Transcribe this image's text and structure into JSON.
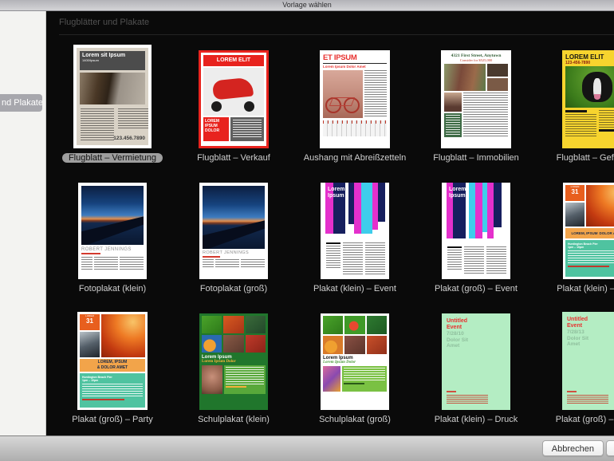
{
  "window": {
    "title": "Vorlage wählen"
  },
  "sidebar": {
    "selected_item": "nd Plakate"
  },
  "section": {
    "header": "Flugblätter und Plakate"
  },
  "templates": [
    {
      "label": "Flugblatt – Vermietung",
      "selected": true,
      "art": {
        "title": "Lorem sit Ipsum",
        "subtitle": "1400/Ipsum",
        "phone": "123.456.7890"
      }
    },
    {
      "label": "Flugblatt – Verkauf",
      "selected": false,
      "art": {
        "band": "LOREM ELIT",
        "box": "LOREM IPSUM DOLOR"
      }
    },
    {
      "label": "Aushang mit Abreißzetteln",
      "selected": false,
      "art": {
        "title": "ET IPSUM",
        "subtitle": "Lorem Ipsum Dolor Amet"
      }
    },
    {
      "label": "Flugblatt – Immobilien",
      "selected": false,
      "art": {
        "title": "4321 First Street, Anytown",
        "subtitle": "Consider for $525,000"
      }
    },
    {
      "label": "Flugblatt – Gefunden",
      "selected": false,
      "art": {
        "title": "LOREM ELIT",
        "phone": "123-456-7890"
      }
    },
    {
      "label": "Fotoplakat (klein)",
      "selected": false,
      "art": {
        "name": "ROBERT JENNINGS"
      }
    },
    {
      "label": "Fotoplakat (groß)",
      "selected": false,
      "art": {
        "name": "ROBERT JENNINGS"
      }
    },
    {
      "label": "Plakat (klein) – Event",
      "selected": false,
      "art": {
        "line1": "Lorem",
        "line2": "Ipsum"
      }
    },
    {
      "label": "Plakat (groß) – Event",
      "selected": false,
      "art": {
        "line1": "Lorem",
        "line2": "Ipsum"
      }
    },
    {
      "label": "Plakat (klein) – Party",
      "selected": false,
      "art": {
        "badge_top": "LOREM",
        "badge": "31",
        "heading1": "LOREM, IPSUM",
        "heading2": "DOLOR AMET",
        "venue": "Huntington Beach Pier",
        "time": "1pm – 10pm"
      }
    },
    {
      "label": "Plakat (groß) – Party",
      "selected": false,
      "art": {
        "badge_top": "LOREM",
        "badge": "31",
        "heading1": "LOREM, IPSUM",
        "heading2": "& DOLOR AMET",
        "venue": "Huntington Beach Pier",
        "time": "1pm – 10pm"
      }
    },
    {
      "label": "Schulplakat (klein)",
      "selected": false,
      "art": {
        "line1": "Lorem Ipsum",
        "line2": "Lorem Ipsum Dolor"
      }
    },
    {
      "label": "Schulplakat (groß)",
      "selected": false,
      "art": {
        "line1": "Lorem Ipsum",
        "line2": "Lorem Ipsum Dolor"
      }
    },
    {
      "label": "Plakat (klein) – Druck",
      "selected": false,
      "art": {
        "line1": "Untitled",
        "line2": "Event",
        "line3": "7/28/10",
        "line4": "Dolor Sit",
        "line5": "Amet"
      }
    },
    {
      "label": "Plakat (groß) – Druck",
      "selected": false,
      "art": {
        "line1": "Untitled",
        "line2": "Event",
        "line3": "7/28/13",
        "line4": "Dolor Sit",
        "line5": "Amet"
      }
    }
  ],
  "footer": {
    "cancel_label": "Abbrechen"
  },
  "colors": {
    "accent_red": "#e8312f",
    "panel_bg": "#0a0a0a",
    "selection_gray": "#9e9e9e"
  }
}
